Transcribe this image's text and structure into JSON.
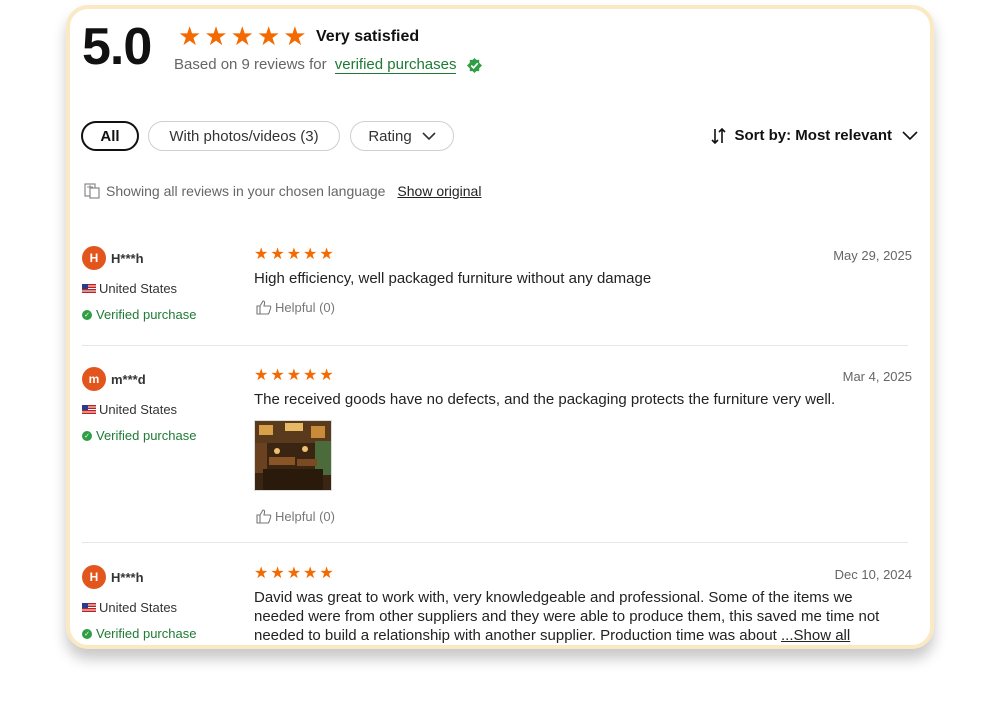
{
  "summary": {
    "score": "5.0",
    "stars": 5,
    "sentiment": "Very satisfied",
    "based_on": "Based on 9 reviews for",
    "verified_link": "verified purchases"
  },
  "filters": [
    {
      "label": "All",
      "active": true
    },
    {
      "label": "With photos/videos (3)",
      "active": false
    },
    {
      "label": "Rating",
      "active": false
    }
  ],
  "sort": {
    "label": "Sort by: Most relevant"
  },
  "language": {
    "notice": "Showing all reviews in your chosen language",
    "show_original": "Show original"
  },
  "reviews": [
    {
      "avatar": "H",
      "name": "H***h",
      "country": "United States",
      "verified": "Verified purchase",
      "rating": 5,
      "date": "May 29, 2025",
      "text": "High efficiency, well packaged furniture without any damage",
      "helpful": "Helpful (0)"
    },
    {
      "avatar": "m",
      "name": "m***d",
      "country": "United States",
      "verified": "Verified purchase",
      "rating": 5,
      "date": "Mar 4, 2025",
      "text": "The received goods have no defects, and the packaging protects the furniture very well.",
      "helpful": "Helpful (0)"
    },
    {
      "avatar": "H",
      "name": "H***h",
      "country": "United States",
      "verified": "Verified purchase",
      "rating": 5,
      "date": "Dec 10, 2024",
      "text": "David was great to work with, very knowledgeable and professional. Some of the items we needed were from other suppliers and they were able to produce them, this saved me time not needed to build a relationship with another supplier. Production time was about",
      "show_all": "...Show all"
    }
  ],
  "colors": {
    "star": "#f26a00",
    "verified_green": "#1f7a35",
    "avatar_bg": "#e2561e",
    "card_border": "#fbe9c4"
  }
}
